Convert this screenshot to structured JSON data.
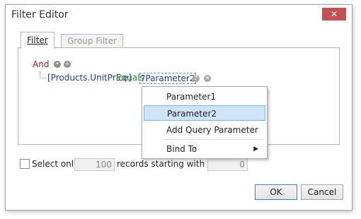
{
  "window": {
    "title": "Filter Editor",
    "close_symbol": "✕"
  },
  "tabs": [
    {
      "label": "Filter",
      "active": true
    },
    {
      "label": "Group Filter",
      "active": false
    }
  ],
  "filter_tree": {
    "root_operator": "And",
    "condition": {
      "field": "[Products.UnitPrice]",
      "operator": "Equals",
      "value": "?Parameter2"
    }
  },
  "context_menu": {
    "items": [
      {
        "label": "Parameter1",
        "selected": false
      },
      {
        "label": "Parameter2",
        "selected": true
      },
      {
        "label": "Add Query Parameter",
        "selected": false
      },
      {
        "label": "Bind To",
        "selected": false,
        "has_submenu": true
      }
    ]
  },
  "options": {
    "select_only_label": "Select only",
    "select_only_checked": false,
    "records_count": "100",
    "records_label": "records starting with index",
    "start_index": "0"
  },
  "buttons": {
    "ok_label": "OK",
    "cancel_label": "Cancel"
  }
}
